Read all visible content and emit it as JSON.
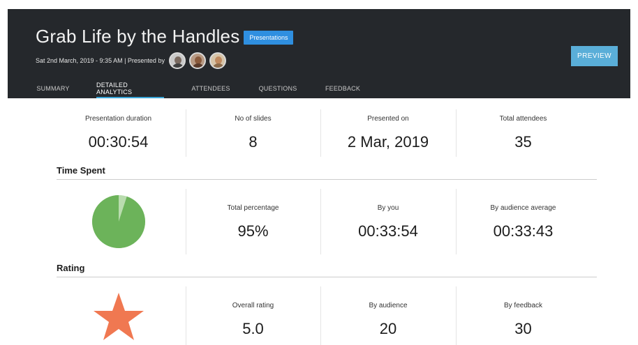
{
  "header": {
    "title": "Grab Life by the Handles",
    "badge": "Presentations",
    "meta": "Sat 2nd March, 2019 - 9:35 AM | Presented by",
    "preview_label": "PREVIEW",
    "tabs": [
      {
        "label": "SUMMARY",
        "active": false
      },
      {
        "label": "DETAILED ANALYTICS",
        "active": true
      },
      {
        "label": "ATTENDEES",
        "active": false
      },
      {
        "label": "QUESTIONS",
        "active": false
      },
      {
        "label": "FEEDBACK",
        "active": false
      }
    ]
  },
  "overview": {
    "duration_label": "Presentation duration",
    "duration_value": "00:30:54",
    "slides_label": "No of slides",
    "slides_value": "8",
    "presented_label": "Presented on",
    "presented_value": "2 Mar, 2019",
    "attendees_label": "Total attendees",
    "attendees_value": "35"
  },
  "time_spent": {
    "title": "Time Spent",
    "pie_percent": 95,
    "pie_color": "#6cb35a",
    "pie_rest_color": "#b9dcae",
    "total_label": "Total percentage",
    "total_value": "95%",
    "you_label": "By you",
    "you_value": "00:33:54",
    "avg_label": "By audience average",
    "avg_value": "00:33:43"
  },
  "rating": {
    "title": "Rating",
    "star_color": "#f07851",
    "overall_label": "Overall rating",
    "overall_value": "5.0",
    "audience_label": "By audience",
    "audience_value": "20",
    "feedback_label": "By feedback",
    "feedback_value": "30"
  }
}
